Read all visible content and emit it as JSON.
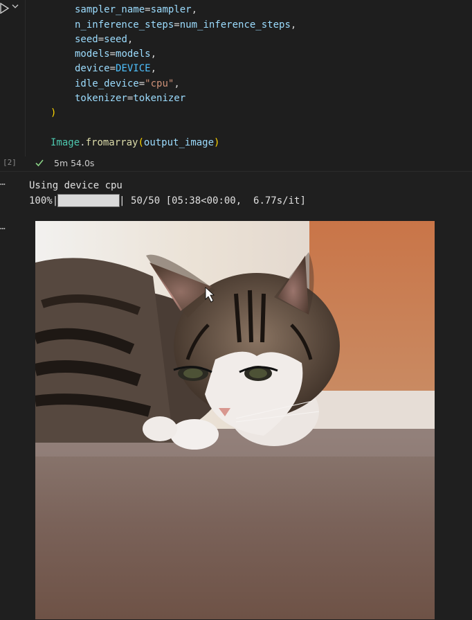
{
  "cell": {
    "execution_count": "[2]",
    "duration": "5m 54.0s",
    "code_lines": [
      {
        "indent": 4,
        "param": "sampler_name",
        "value": "sampler",
        "value_kind": "var"
      },
      {
        "indent": 4,
        "param": "n_inference_steps",
        "value": "num_inference_steps",
        "value_kind": "var"
      },
      {
        "indent": 4,
        "param": "seed",
        "value": "seed",
        "value_kind": "var"
      },
      {
        "indent": 4,
        "param": "models",
        "value": "models",
        "value_kind": "var"
      },
      {
        "indent": 4,
        "param": "device",
        "value": "DEVICE",
        "value_kind": "const"
      },
      {
        "indent": 4,
        "param": "idle_device",
        "value": "\"cpu\"",
        "value_kind": "str"
      },
      {
        "indent": 4,
        "param": "tokenizer",
        "value": "tokenizer",
        "value_kind": "var"
      }
    ],
    "closing_paren": ")",
    "last_line": {
      "class": "Image",
      "func": "fromarray",
      "arg": "output_image"
    }
  },
  "output": {
    "line1": "Using device cpu",
    "progress_percent_text": "100%|",
    "progress_fraction": 1.0,
    "progress_suffix": "| 50/50 [05:38<00:00,  6.77s/it]"
  },
  "image": {
    "subject": "tabby cat lying on wooden floor",
    "colors": {
      "wall": "#e8ddd3",
      "orange_panel": "#c97a4c",
      "floor": "#7a6055"
    }
  },
  "icons": {
    "run": "run-triangle-icon",
    "chevron": "chevron-down-icon",
    "check": "check-icon",
    "more": "more-dots-icon"
  },
  "colors": {
    "background": "#1f1f1f",
    "check_green": "#89d185"
  }
}
